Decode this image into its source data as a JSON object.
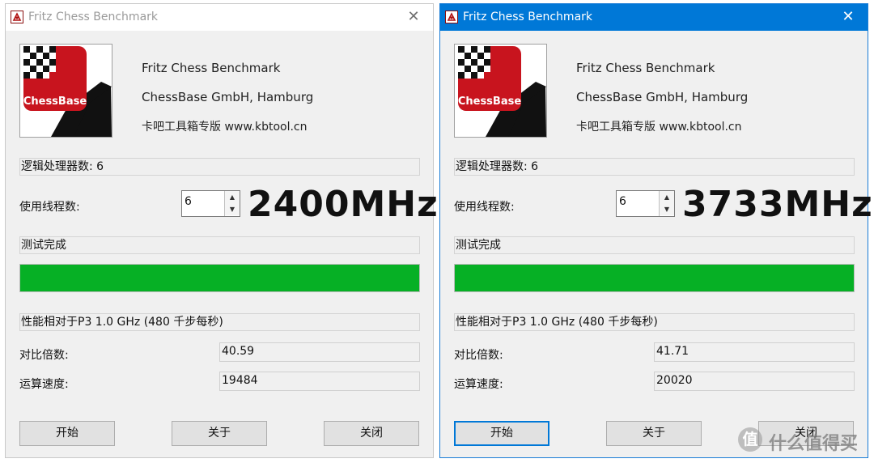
{
  "windows": [
    {
      "title": "Fritz Chess Benchmark",
      "logo_text": "ChessBase",
      "info": {
        "line1": "Fritz Chess Benchmark",
        "line2": "ChessBase GmbH, Hamburg",
        "line3": "卡吧工具箱专版 www.kbtool.cn"
      },
      "logical_processors": "逻辑处理器数: 6",
      "threads_label": "使用线程数:",
      "threads_value": "6",
      "frequency_overlay": "2400MHz",
      "status": "测试完成",
      "progress_percent": 100,
      "perf_caption": "性能相对于P3 1.0 GHz (480 千步每秒)",
      "ratio_label": "对比倍数:",
      "ratio_value": "40.59",
      "speed_label": "运算速度:",
      "speed_value": "19484",
      "buttons": {
        "start": "开始",
        "about": "关于",
        "close": "关闭"
      }
    },
    {
      "title": "Fritz Chess Benchmark",
      "logo_text": "ChessBase",
      "info": {
        "line1": "Fritz Chess Benchmark",
        "line2": "ChessBase GmbH, Hamburg",
        "line3": "卡吧工具箱专版 www.kbtool.cn"
      },
      "logical_processors": "逻辑处理器数: 6",
      "threads_label": "使用线程数:",
      "threads_value": "6",
      "frequency_overlay": "3733MHz",
      "status": "测试完成",
      "progress_percent": 100,
      "perf_caption": "性能相对于P3 1.0 GHz (480 千步每秒)",
      "ratio_label": "对比倍数:",
      "ratio_value": "41.71",
      "speed_label": "运算速度:",
      "speed_value": "20020",
      "buttons": {
        "start": "开始",
        "about": "关于",
        "close": "关闭"
      }
    }
  ],
  "watermark": {
    "icon_char": "值",
    "text": "什么值得买"
  },
  "colors": {
    "active_title": "#0078d7",
    "progress": "#06b025",
    "logo_red": "#c8141e"
  }
}
